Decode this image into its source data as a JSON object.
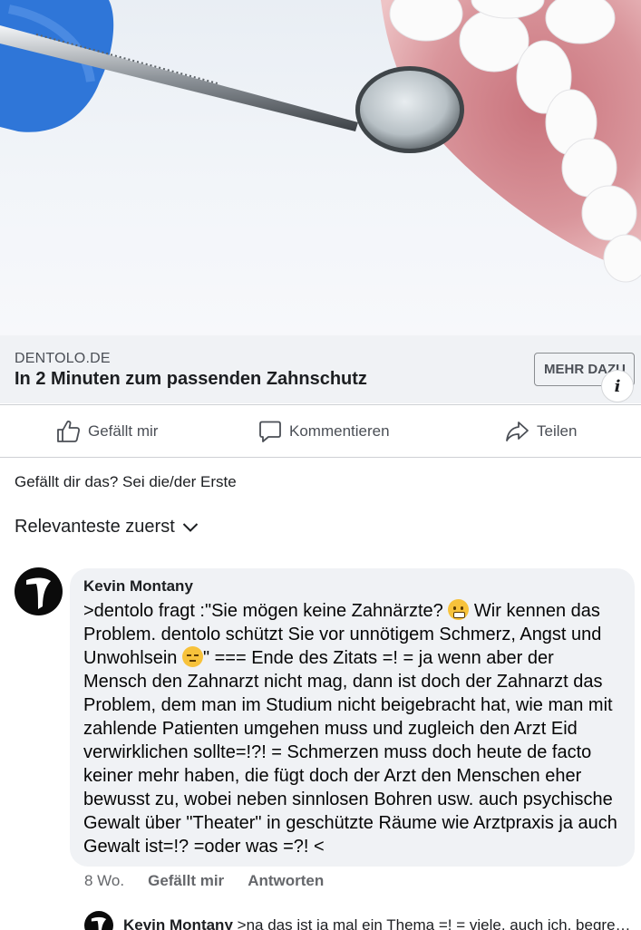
{
  "hero": {
    "description_icon": "dental-mirror-and-dentures-image"
  },
  "link_preview": {
    "domain": "DENTOLO.DE",
    "title": "In 2 Minuten zum passenden Zahnschutz",
    "cta_label": "MEHR DAZU",
    "info_icon": "info-icon",
    "info_glyph": "i"
  },
  "actions": {
    "like": "Gefällt mir",
    "comment": "Kommentieren",
    "share": "Teilen"
  },
  "reactions_text": "Gefällt dir das? Sei die/der Erste",
  "sort_label": "Relevanteste zuerst",
  "comment": {
    "author": "Kevin Montany",
    "text_part1": ">dentolo fragt :\"Sie mögen keine Zahnärzte? ",
    "text_part2": " Wir kennen das Problem. dentolo schützt Sie vor unnötigem Schmerz, Angst und Unwohlsein ",
    "text_part3": "\" === Ende des Zitats =! = ja wenn aber der Mensch den  Zahnarzt nicht mag, dann ist doch der Zahnarzt das Problem, dem man im Studium nicht beigebracht hat, wie man mit zahlende Patienten umgehen muss und zugleich den Arzt Eid verwirklichen sollte=!?! = Schmerzen muss doch heute de facto keiner mehr haben, die fügt doch der Arzt den Menschen eher bewusst zu, wobei neben sinnlosen Bohren usw. auch psychische Gewalt über \"Theater\" in geschützte Räume wie Arztpraxis ja auch Gewalt ist=!? =oder was =?! <",
    "time": "8 Wo.",
    "like": "Gefällt mir",
    "reply": "Antworten"
  },
  "reply": {
    "author": "Kevin Montany",
    "text": ">na das ist ja mal ein Thema =! = viele, auch ich, begreife..."
  },
  "colors": {
    "bar_bg": "#f0f2f5",
    "muted": "#65676b",
    "emoji": "#f7c23b"
  }
}
